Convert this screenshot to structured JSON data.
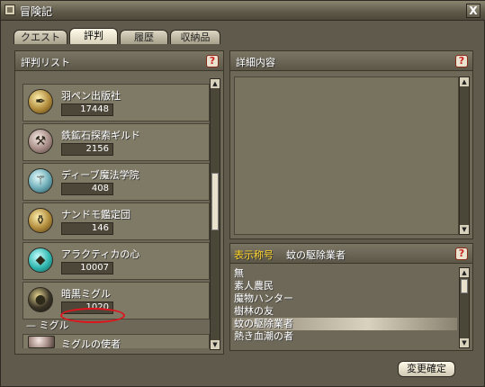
{
  "window": {
    "title": "冒険記",
    "close": "X"
  },
  "tabs": [
    {
      "label": "クエスト"
    },
    {
      "label": "評判"
    },
    {
      "label": "履歴"
    },
    {
      "label": "収納品"
    }
  ],
  "left_panel": {
    "title": "評判リスト",
    "help": "?",
    "items": [
      {
        "name": "羽ペン出版社",
        "value": "17448",
        "icon": "quill-icon"
      },
      {
        "name": "鉄鉱石探索ギルド",
        "value": "2156",
        "icon": "pickaxe-icon"
      },
      {
        "name": "ディーブ魔法学院",
        "value": "408",
        "icon": "magic-staff-icon"
      },
      {
        "name": "ナンドモ鑑定団",
        "value": "146",
        "icon": "jar-icon"
      },
      {
        "name": "アラクティカの心",
        "value": "10007",
        "icon": "gem-icon"
      },
      {
        "name": "暗黒ミグル",
        "value": "1020",
        "icon": "dark-orb-icon"
      }
    ],
    "group_label": "ミグル",
    "sub_items": [
      {
        "name": "ミグルの使者",
        "icon": "emblem-icon"
      }
    ]
  },
  "detail_panel": {
    "title": "詳細内容",
    "help": "?"
  },
  "title_panel": {
    "label": "表示称号",
    "current": "蚊の駆除業者",
    "help": "?",
    "titles": [
      "無",
      "素人農民",
      "魔物ハンター",
      "樹林の友",
      "蚊の駆除業者",
      "熱き血潮の者"
    ],
    "selected_index": 4
  },
  "confirm_button": {
    "label": "変更確定"
  }
}
